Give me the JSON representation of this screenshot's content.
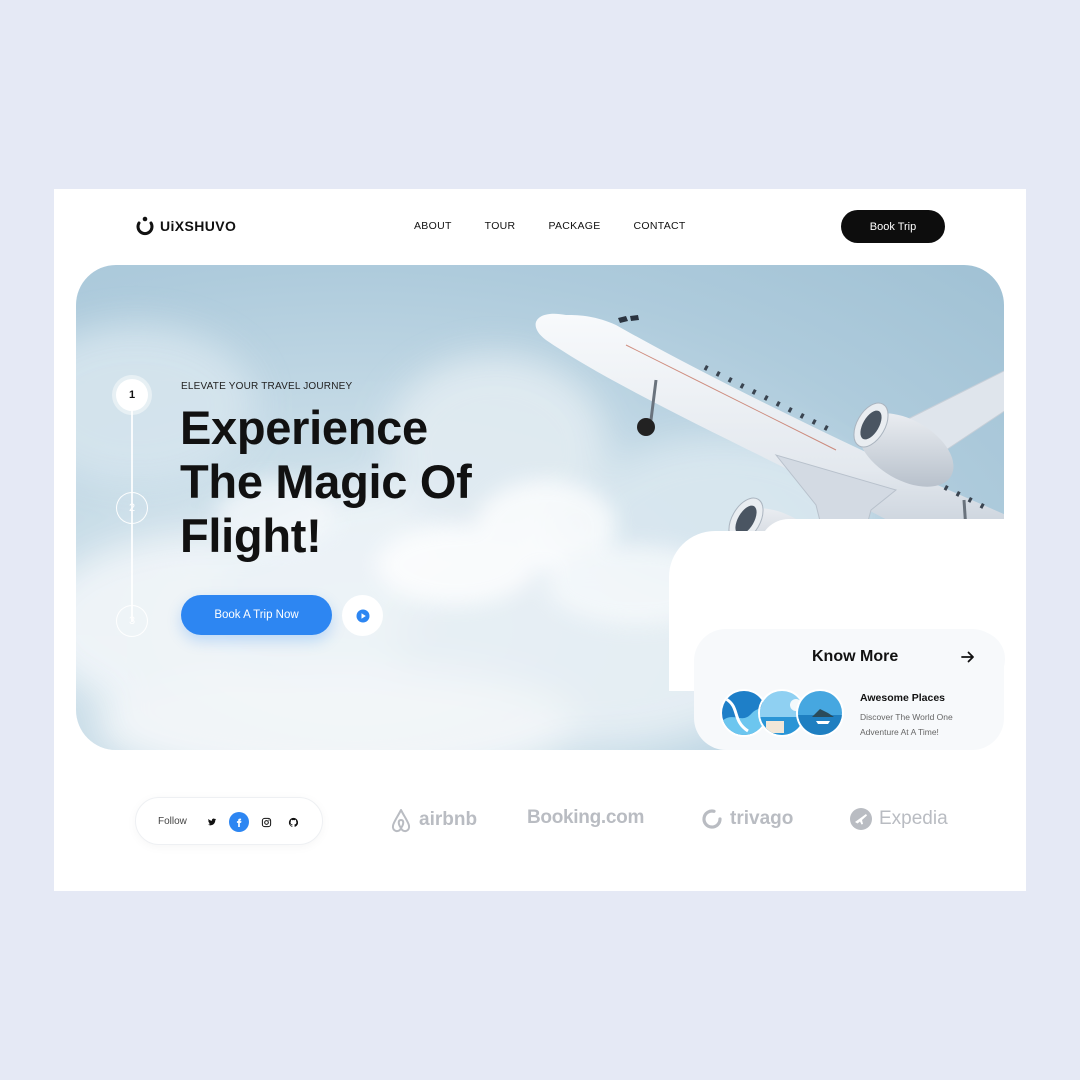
{
  "header": {
    "logo_text": "UiXSHUVO",
    "nav": [
      "ABOUT",
      "TOUR",
      "PACKAGE",
      "CONTACT"
    ],
    "book_trip": "Book Trip"
  },
  "hero": {
    "steps": [
      "1",
      "2",
      "3"
    ],
    "active_step": "1",
    "eyebrow": "ELEVATE YOUR TRAVEL JOURNEY",
    "headline_lines": [
      "Experience",
      "The Magic Of",
      "Flight!"
    ],
    "cta": "Book A Trip Now"
  },
  "know_more": {
    "title": "Know More",
    "place_title": "Awesome Places",
    "place_desc": "Discover The World One Adventure At A Time!"
  },
  "footer": {
    "follow_label": "Follow",
    "social_icons": [
      "twitter-icon",
      "facebook-icon",
      "instagram-icon",
      "github-icon"
    ],
    "brands": [
      "airbnb",
      "Booking.com",
      "trivago",
      "Expedia"
    ]
  },
  "colors": {
    "page_bg": "#e5e9f5",
    "accent": "#2d86f2",
    "dark": "#0d0d0d",
    "brand_grey": "#b9bcc2"
  }
}
